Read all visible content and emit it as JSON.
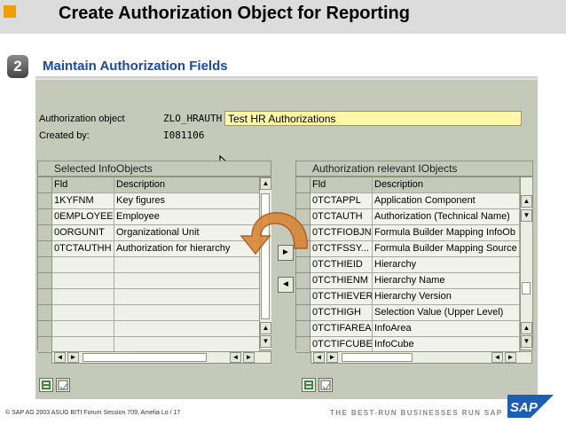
{
  "slide": {
    "title": "Create Authorization Object for Reporting",
    "step": "2",
    "heading": "Maintain Authorization Fields",
    "footer": "©  SAP AG 2003  ASUG BITI Forum Session 709, Amelia Lo / 17",
    "slogan": "THE BEST-RUN BUSINESSES RUN SAP",
    "logo_text": "SAP",
    "accent_color": "#f0a000",
    "heading_color": "#1a4aa0"
  },
  "form": {
    "auth_object_label": "Authorization object",
    "auth_object_value": "ZLO_HRAUTH",
    "auth_object_text": "Test HR Authorizations",
    "created_by_label": "Created by:",
    "created_by_value": "I081106"
  },
  "left_table": {
    "title": "Selected InfoObjects",
    "col_fld": "Fld",
    "col_desc": "Description",
    "rows": [
      {
        "fld": "1KYFNM",
        "desc": "Key figures"
      },
      {
        "fld": "0EMPLOYEE",
        "desc": "Employee"
      },
      {
        "fld": "0ORGUNIT",
        "desc": "Organizational Unit"
      },
      {
        "fld": "0TCTAUTHH",
        "desc": "Authorization for hierarchy"
      }
    ]
  },
  "right_table": {
    "title": "Authorization relevant IObjects",
    "col_fld": "Fld",
    "col_desc": "Description",
    "rows": [
      {
        "fld": "0TCTAPPL",
        "desc": "Application Component"
      },
      {
        "fld": "0TCTAUTH",
        "desc": "Authorization (Technical Name)"
      },
      {
        "fld": "0TCTFIOBJN",
        "desc": "Formula Builder Mapping InfoOb"
      },
      {
        "fld": "0TCTFSSY...",
        "desc": "Formula Builder Mapping Source"
      },
      {
        "fld": "0TCTHIEID",
        "desc": "Hierarchy"
      },
      {
        "fld": "0TCTHIENM",
        "desc": "Hierarchy Name"
      },
      {
        "fld": "0TCTHIEVER",
        "desc": "Hierarchy Version"
      },
      {
        "fld": "0TCTHIGH",
        "desc": "Selection Value (Upper Level)"
      },
      {
        "fld": "0TCTIFAREA",
        "desc": "InfoArea"
      },
      {
        "fld": "0TCTIFCUBE",
        "desc": "InfoCube"
      }
    ]
  },
  "icons": {
    "move_right": "►",
    "move_left": "◄",
    "scroll_up": "▲",
    "scroll_down": "▼",
    "scroll_left": "◄",
    "scroll_right": "►"
  }
}
